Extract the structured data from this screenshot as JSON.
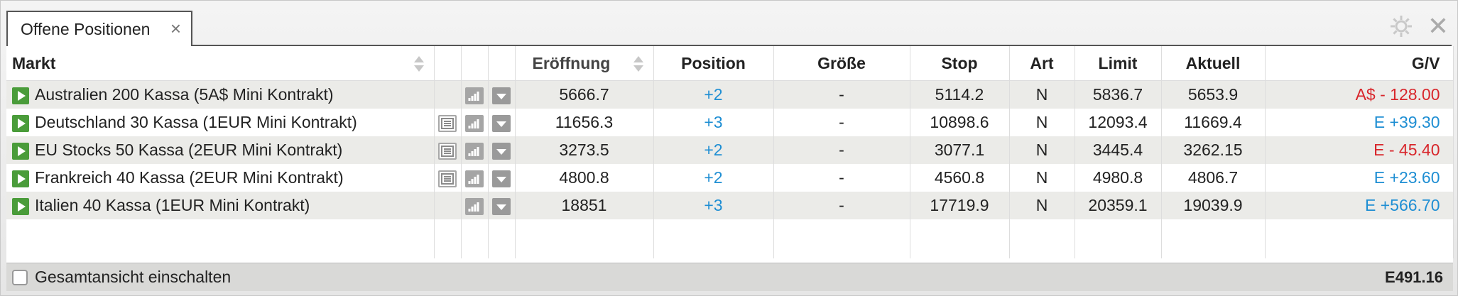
{
  "tab": {
    "label": "Offene Positionen",
    "close": "×"
  },
  "window": {
    "close": "✕"
  },
  "columns": {
    "market": "Markt",
    "open": "Eröffnung",
    "position": "Position",
    "size": "Größe",
    "stop": "Stop",
    "art": "Art",
    "limit": "Limit",
    "current": "Aktuell",
    "pl": "G/V"
  },
  "rows": [
    {
      "market": "Australien 200 Kassa (5A$ Mini Kontrakt)",
      "has_news": false,
      "open": "5666.7",
      "position": "+2",
      "size": "-",
      "stop": "5114.2",
      "art": "N",
      "limit": "5836.7",
      "current": "5653.9",
      "pl": "A$ - 128.00",
      "pl_color": "#d8262b"
    },
    {
      "market": "Deutschland 30 Kassa (1EUR Mini Kontrakt)",
      "has_news": true,
      "open": "11656.3",
      "position": "+3",
      "size": "-",
      "stop": "10898.6",
      "art": "N",
      "limit": "12093.4",
      "current": "11669.4",
      "pl": "E +39.30",
      "pl_color": "#1e8ed3"
    },
    {
      "market": "EU Stocks 50 Kassa (2EUR Mini Kontrakt)",
      "has_news": true,
      "open": "3273.5",
      "position": "+2",
      "size": "-",
      "stop": "3077.1",
      "art": "N",
      "limit": "3445.4",
      "current": "3262.15",
      "pl": "E - 45.40",
      "pl_color": "#d8262b"
    },
    {
      "market": "Frankreich 40 Kassa (2EUR Mini Kontrakt)",
      "has_news": true,
      "open": "4800.8",
      "position": "+2",
      "size": "-",
      "stop": "4560.8",
      "art": "N",
      "limit": "4980.8",
      "current": "4806.7",
      "pl": "E +23.60",
      "pl_color": "#1e8ed3"
    },
    {
      "market": "Italien 40 Kassa (1EUR Mini Kontrakt)",
      "has_news": false,
      "open": "18851",
      "position": "+3",
      "size": "-",
      "stop": "17719.9",
      "art": "N",
      "limit": "20359.1",
      "current": "19039.9",
      "pl": "E +566.70",
      "pl_color": "#1e8ed3"
    }
  ],
  "footer": {
    "toggle_label": "Gesamtansicht einschalten",
    "total": "E491.16"
  },
  "colors": {
    "position": "#1e8ed3",
    "play": "#4a9c3a"
  },
  "icons": {
    "row_play": "play-icon",
    "news": "news-icon",
    "chart": "chart-icon",
    "menu": "dropdown-icon",
    "settings": "gear-icon",
    "close": "close-icon",
    "sort": "sort-icon"
  }
}
